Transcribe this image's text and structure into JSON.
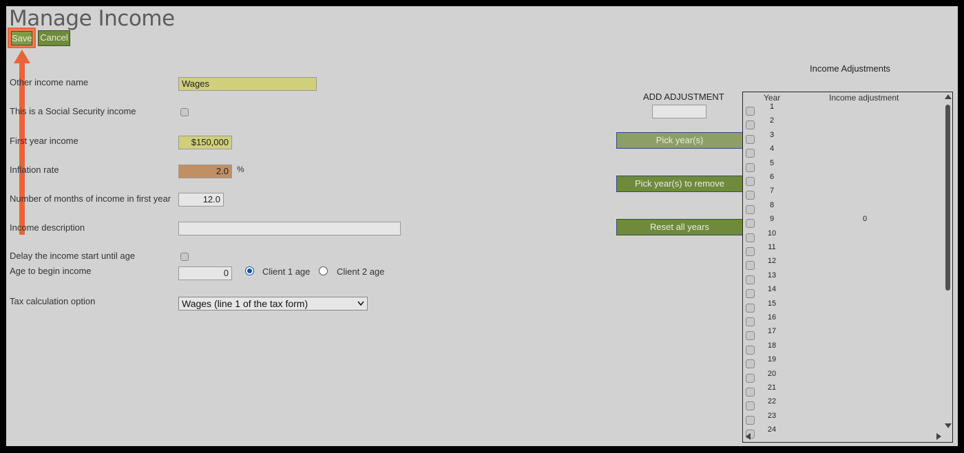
{
  "page": {
    "title": "Manage Income"
  },
  "toolbar": {
    "save_label": "Save",
    "cancel_label": "Cancel"
  },
  "form": {
    "other_income_name_label": "Other income name",
    "other_income_name_value": "Wages",
    "social_security_label": "This is a Social Security income",
    "first_year_income_label": "First year income",
    "first_year_income_value": "$150,000",
    "inflation_rate_label": "Inflation rate",
    "inflation_rate_value": "2.0",
    "inflation_rate_unit": "%",
    "months_label": "Number of months of income in first year",
    "months_value": "12.0",
    "description_label": "Income description",
    "description_value": "",
    "delay_label": "Delay the income start until age",
    "age_label": "Age to begin income",
    "age_value": "0",
    "client1_label": "Client 1 age",
    "client2_label": "Client 2 age",
    "tax_label": "Tax calculation option",
    "tax_value": "Wages (line 1 of the tax form)"
  },
  "adjustments": {
    "panel_title": "Income Adjustments",
    "add_label": "ADD ADJUSTMENT",
    "add_value": "",
    "pick_years_label": "Pick year(s)",
    "pick_remove_label": "Pick year(s) to remove",
    "reset_label": "Reset all years",
    "col_year": "Year",
    "col_adjustment": "Income adjustment",
    "rows": [
      {
        "year": "1",
        "value": ""
      },
      {
        "year": "2",
        "value": ""
      },
      {
        "year": "3",
        "value": ""
      },
      {
        "year": "4",
        "value": ""
      },
      {
        "year": "5",
        "value": ""
      },
      {
        "year": "6",
        "value": ""
      },
      {
        "year": "7",
        "value": ""
      },
      {
        "year": "8",
        "value": ""
      },
      {
        "year": "9",
        "value": "0"
      },
      {
        "year": "10",
        "value": ""
      },
      {
        "year": "11",
        "value": ""
      },
      {
        "year": "12",
        "value": ""
      },
      {
        "year": "13",
        "value": ""
      },
      {
        "year": "14",
        "value": ""
      },
      {
        "year": "15",
        "value": ""
      },
      {
        "year": "16",
        "value": ""
      },
      {
        "year": "17",
        "value": ""
      },
      {
        "year": "18",
        "value": ""
      },
      {
        "year": "19",
        "value": ""
      },
      {
        "year": "20",
        "value": ""
      },
      {
        "year": "21",
        "value": ""
      },
      {
        "year": "22",
        "value": ""
      },
      {
        "year": "23",
        "value": ""
      },
      {
        "year": "24",
        "value": ""
      }
    ]
  },
  "colors": {
    "accent_green": "#6e8a3a",
    "highlight_yellow": "#cfcf7c",
    "inflation_orange": "#c28f63",
    "annotation_orange": "#e8643a"
  }
}
